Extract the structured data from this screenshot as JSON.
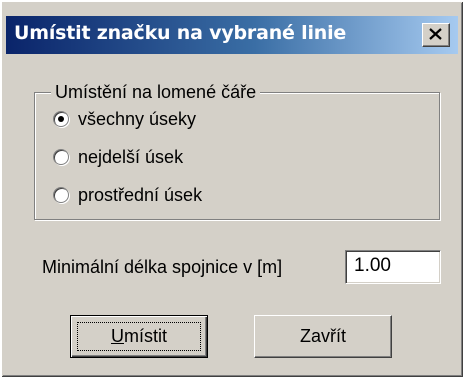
{
  "dialog": {
    "title": "Umístit značku na vybrané linie",
    "close_glyph": "close-icon"
  },
  "group": {
    "legend": "Umístění na lomené čáře",
    "options": [
      {
        "label": "všechny úseky",
        "selected": true
      },
      {
        "label": "nejdelší úsek",
        "selected": false
      },
      {
        "label": "prostřední úsek",
        "selected": false
      }
    ]
  },
  "min_length": {
    "label": "Minimální délka spojnice v [m]",
    "value": "1.00"
  },
  "buttons": {
    "place_access": "U",
    "place_rest": "místit",
    "close_label": "Zavřít"
  },
  "colors": {
    "title_start": "#0a246a",
    "title_end": "#a6caf0",
    "face": "#d4d0c8"
  }
}
